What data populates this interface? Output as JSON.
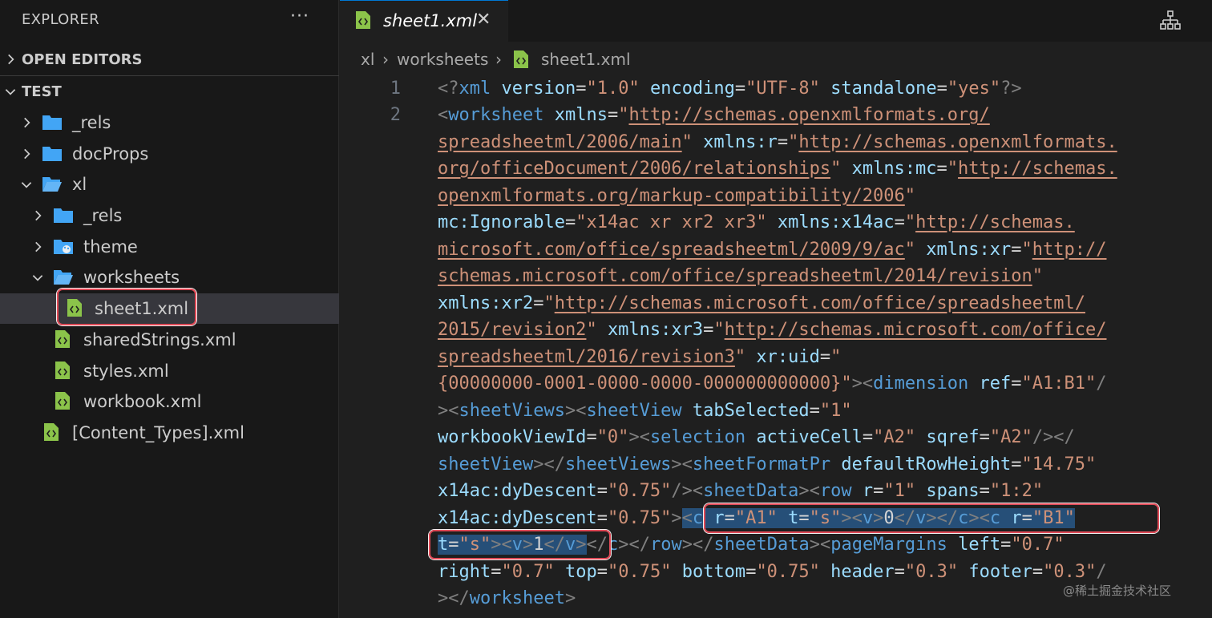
{
  "sidebar": {
    "title": "EXPLORER",
    "more": "···",
    "open_editors": "OPEN EDITORS",
    "workspace": "TEST",
    "tree": [
      {
        "name": "_rels"
      },
      {
        "name": "docProps"
      },
      {
        "name": "xl"
      },
      {
        "name": "_rels"
      },
      {
        "name": "theme"
      },
      {
        "name": "worksheets"
      },
      {
        "name": "sheet1.xml"
      },
      {
        "name": "sharedStrings.xml"
      },
      {
        "name": "styles.xml"
      },
      {
        "name": "workbook.xml"
      },
      {
        "name": "[Content_Types].xml"
      }
    ]
  },
  "editor": {
    "tab": {
      "label": "sheet1.xml",
      "close": "✕"
    },
    "breadcrumb": [
      "xl",
      "worksheets",
      "sheet1.xml"
    ],
    "separator": "›",
    "line_numbers": [
      "1",
      "2"
    ]
  },
  "code": {
    "l0": [
      "<?",
      "xml",
      " ",
      "version",
      "=",
      "\"1.0\"",
      " ",
      "encoding",
      "=",
      "\"UTF-8\"",
      " ",
      "standalone",
      "=",
      "\"yes\"",
      "?>"
    ],
    "l1": [
      "<",
      "worksheet",
      " ",
      "xmlns",
      "=",
      "\"",
      "http://schemas.openxmlformats.org/"
    ],
    "l2": [
      "spreadsheetml/2006/main",
      "\"",
      " ",
      "xmlns:r",
      "=",
      "\"",
      "http://schemas.openxmlformats."
    ],
    "l3": [
      "org/officeDocument/2006/relationships",
      "\"",
      " ",
      "xmlns:mc",
      "=",
      "\"",
      "http://schemas."
    ],
    "l4": [
      "openxmlformats.org/markup-compatibility/2006",
      "\""
    ],
    "l5": [
      "mc:Ignorable",
      "=",
      "\"x14ac xr xr2 xr3\"",
      " ",
      "xmlns:x14ac",
      "=",
      "\"",
      "http://schemas."
    ],
    "l6": [
      "microsoft.com/office/spreadsheetml/2009/9/ac",
      "\"",
      " ",
      "xmlns:xr",
      "=",
      "\"",
      "http://"
    ],
    "l7": [
      "schemas.microsoft.com/office/spreadsheetml/2014/revision",
      "\""
    ],
    "l8": [
      "xmlns:xr2",
      "=",
      "\"",
      "http://schemas.microsoft.com/office/spreadsheetml/"
    ],
    "l9": [
      "2015/revision2",
      "\"",
      " ",
      "xmlns:xr3",
      "=",
      "\"",
      "http://schemas.microsoft.com/office/"
    ],
    "l10": [
      "spreadsheetml/2016/revision3",
      "\"",
      " ",
      "xr:uid",
      "=",
      "\""
    ],
    "l11": [
      "{00000000-0001-0000-0000-000000000000}",
      "\"",
      "><",
      "dimension",
      " ",
      "ref",
      "=",
      "\"A1:B1\"",
      "/"
    ],
    "l12": [
      "><",
      "sheetViews",
      "><",
      "sheetView",
      " ",
      "tabSelected",
      "=",
      "\"1\""
    ],
    "l13": [
      "workbookViewId",
      "=",
      "\"0\"",
      "><",
      "selection",
      " ",
      "activeCell",
      "=",
      "\"A2\"",
      " ",
      "sqref",
      "=",
      "\"A2\"",
      "/></"
    ],
    "l14": [
      "sheetView",
      "></",
      "sheetViews",
      "><",
      "sheetFormatPr",
      " ",
      "defaultRowHeight",
      "=",
      "\"14.75\""
    ],
    "l15": [
      "x14ac:dyDescent",
      "=",
      "\"0.75\"",
      "/><",
      "sheetData",
      "><",
      "row",
      " ",
      "r",
      "=",
      "\"1\"",
      " ",
      "spans",
      "=",
      "\"1:2\""
    ],
    "l16": [
      "x14ac:dyDescent",
      "=",
      "\"0.75\"",
      ">",
      "<",
      "c",
      " ",
      "r",
      "=",
      "\"A1\"",
      " ",
      "t",
      "=",
      "\"s\"",
      "><",
      "v",
      ">",
      "0",
      "</",
      "v",
      "></",
      "c",
      "><",
      "c",
      " ",
      "r",
      "=",
      "\"B1\""
    ],
    "l17": [
      "t",
      "=",
      "\"s\"",
      "><",
      "v",
      ">",
      "1",
      "</",
      "v",
      ">",
      "</",
      "c",
      "></",
      "row",
      "></",
      "sheetData",
      "><",
      "pageMargins",
      " ",
      "left",
      "=",
      "\"0.7\""
    ],
    "l18": [
      "right",
      "=",
      "\"0.7\"",
      " ",
      "top",
      "=",
      "\"0.75\"",
      " ",
      "bottom",
      "=",
      "\"0.75\"",
      " ",
      "header",
      "=",
      "\"0.3\"",
      " ",
      "footer",
      "=",
      "\"0.3\"",
      "/"
    ],
    "l19": [
      "></",
      "worksheet",
      ">"
    ]
  },
  "watermark": "@稀土掘金技术社区",
  "colors": {
    "tag": "#569cd6",
    "attribute": "#9cdcfe",
    "string": "#ce9178",
    "punctuation": "#808080",
    "selection": "#264f78",
    "highlight_box": "#e04a57"
  }
}
